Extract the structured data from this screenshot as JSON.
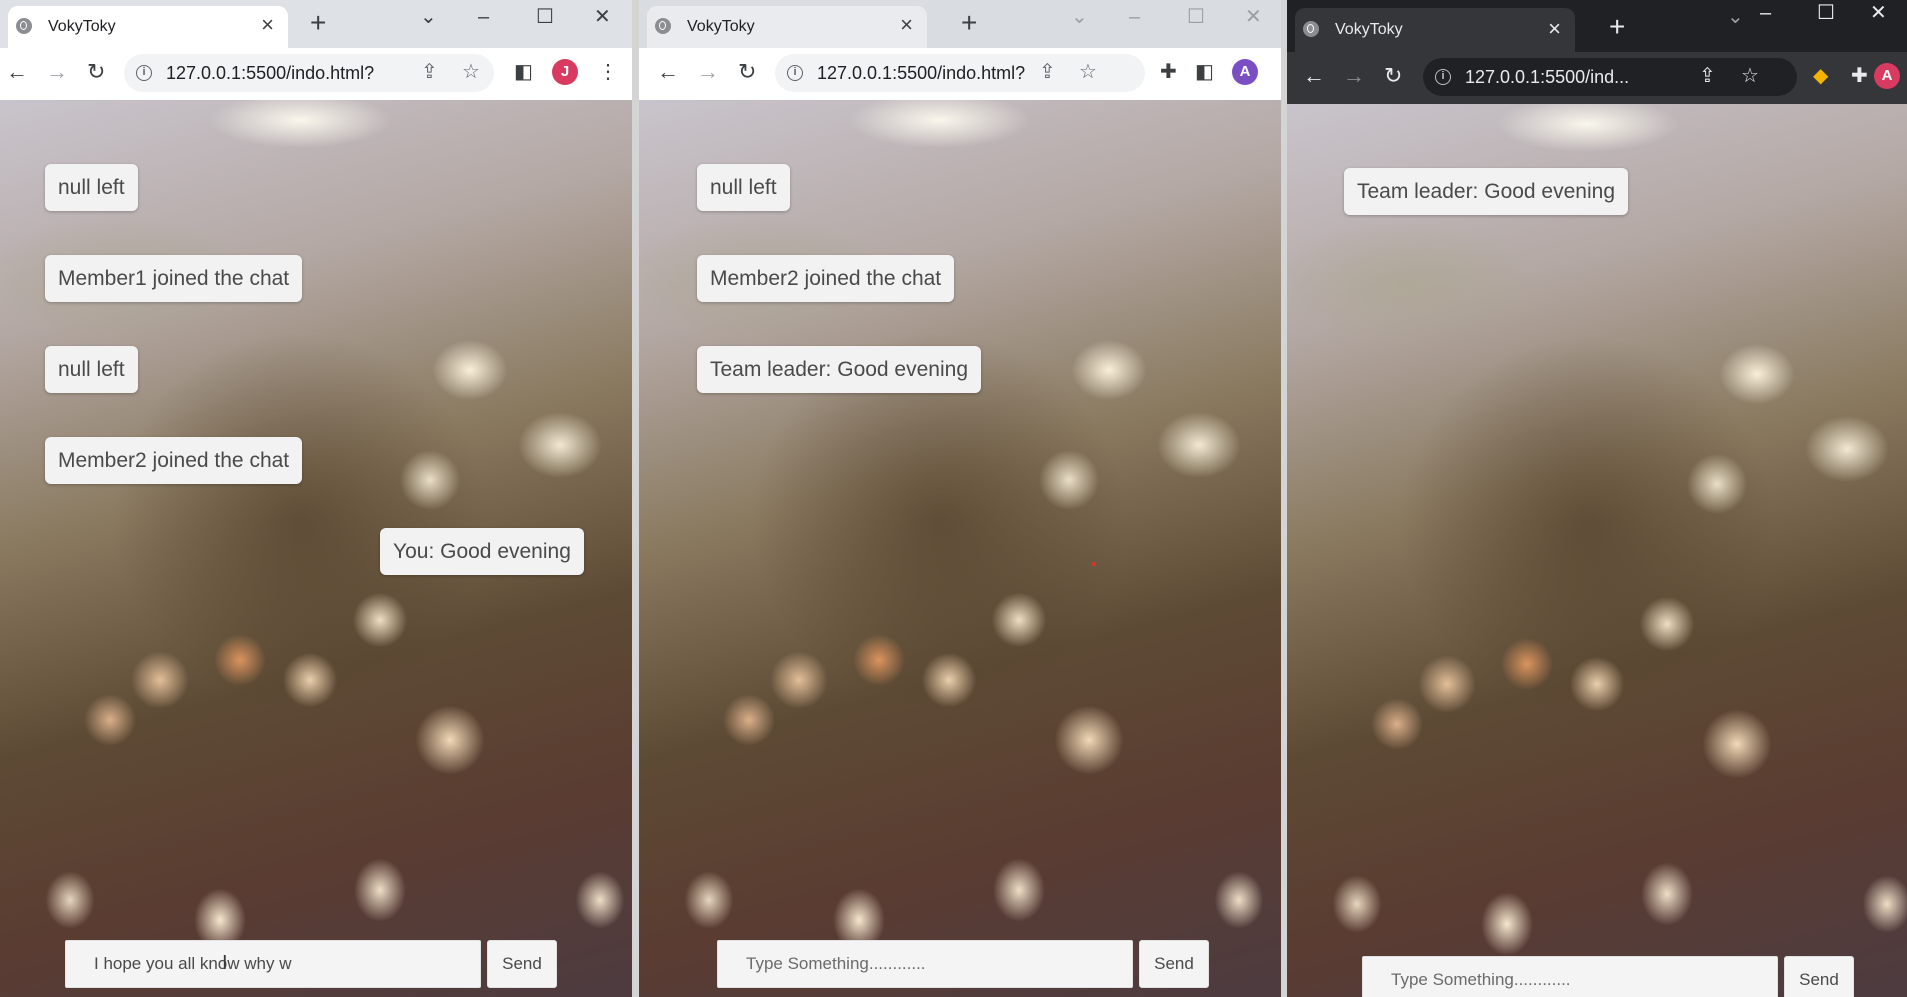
{
  "windows": [
    {
      "tab_title": "VokyToky",
      "url": "127.0.0.1:5500/indo.html?",
      "profile_initial": "J",
      "profile_color": "#d93a5f",
      "messages": [
        "null left",
        "Member1 joined the chat",
        "null left",
        "Member2 joined the chat",
        "You: Good evening"
      ],
      "input_value": "I hope you all know why w",
      "input_placeholder": "Type Something............",
      "send_label": "Send"
    },
    {
      "tab_title": "VokyToky",
      "url": "127.0.0.1:5500/indo.html?",
      "profile_initial": "A",
      "profile_color": "#7a4fc4",
      "messages": [
        "null left",
        "Member2 joined the chat",
        "Team leader: Good evening"
      ],
      "input_value": "",
      "input_placeholder": "Type Something............",
      "send_label": "Send"
    },
    {
      "tab_title": "VokyToky",
      "url": "127.0.0.1:5500/ind...",
      "profile_initial": "A",
      "profile_color": "#d93a5f",
      "messages": [
        "Team leader: Good evening"
      ],
      "input_value": "",
      "input_placeholder": "Type Something............",
      "send_label": "Send"
    }
  ],
  "icons": {
    "close": "×",
    "new_tab": "+",
    "back": "←",
    "forward": "→",
    "reload": "↻",
    "minimize": "–",
    "maximize": "☐",
    "window_close": "✕",
    "tab_search": "⌄",
    "share": "⇪",
    "star": "☆",
    "sidepanel": "◧",
    "menu": "⋮",
    "extensions": "✚",
    "text_cursor": "I",
    "diamond": "◆"
  },
  "colors": {
    "bubble_bg": "#f2f2f2",
    "bubble_text": "#4a4a4a",
    "dark_chrome": "#202124",
    "light_chrome": "#dee1e6"
  }
}
